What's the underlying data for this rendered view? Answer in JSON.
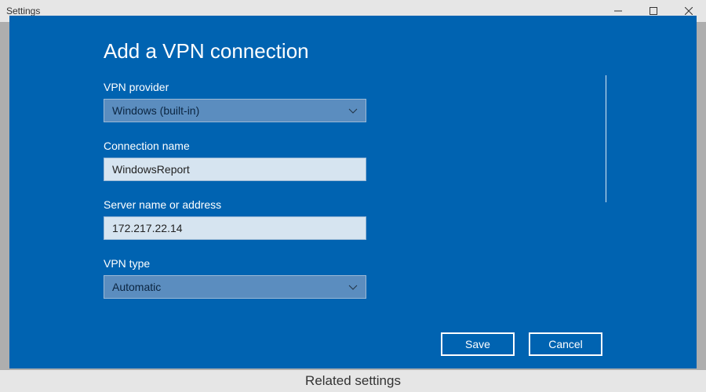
{
  "window": {
    "title": "Settings"
  },
  "background": {
    "related_heading": "Related settings"
  },
  "modal": {
    "title": "Add a VPN connection",
    "fields": {
      "provider": {
        "label": "VPN provider",
        "value": "Windows (built-in)"
      },
      "connection_name": {
        "label": "Connection name",
        "value": "WindowsReport"
      },
      "server": {
        "label": "Server name or address",
        "value": "172.217.22.14"
      },
      "vpn_type": {
        "label": "VPN type",
        "value": "Automatic"
      }
    },
    "buttons": {
      "save": "Save",
      "cancel": "Cancel"
    }
  }
}
